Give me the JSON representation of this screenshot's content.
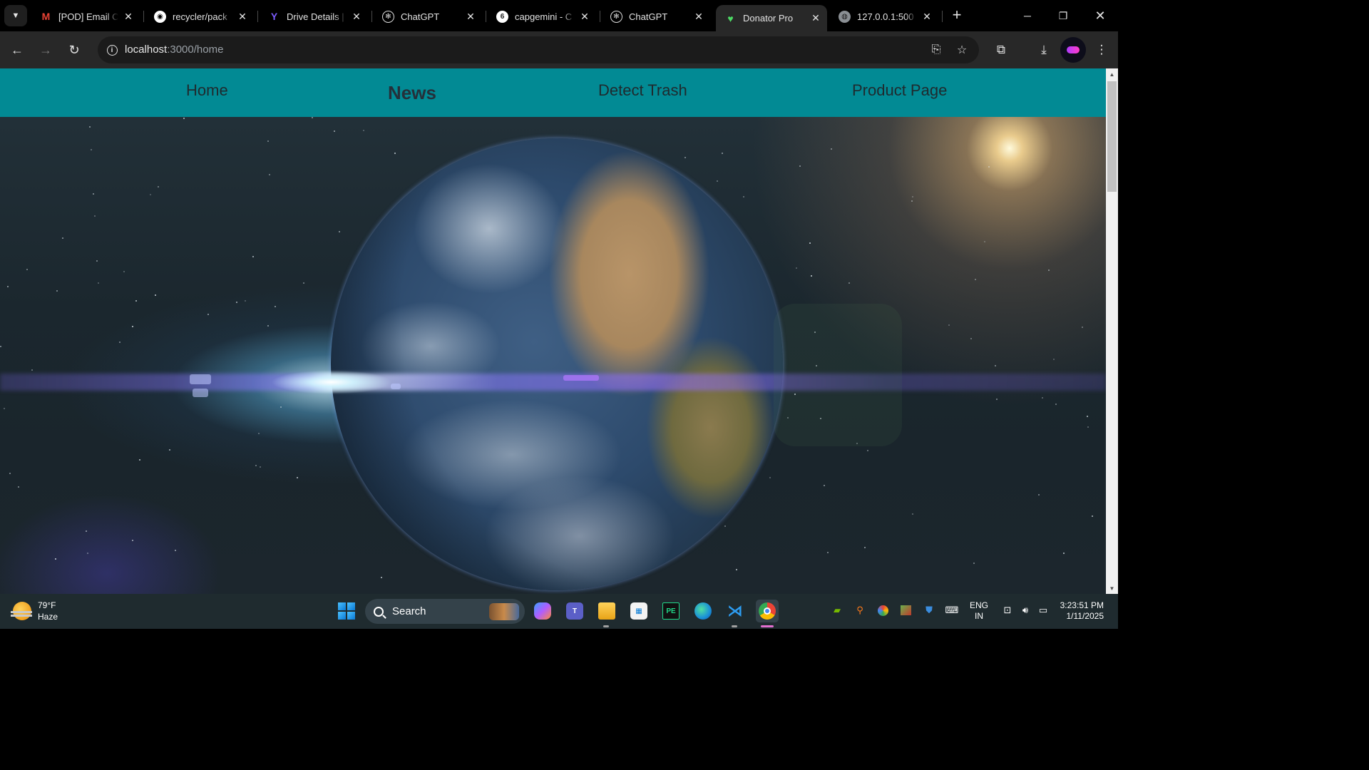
{
  "browser": {
    "tabs": [
      {
        "title": "[POD] Email C",
        "favicon": "gmail-icon",
        "active": false
      },
      {
        "title": "recycler/pack",
        "favicon": "github-icon",
        "active": false
      },
      {
        "title": "Drive Details |",
        "favicon": "drive-details-icon",
        "active": false
      },
      {
        "title": "ChatGPT",
        "favicon": "chatgpt-icon",
        "active": false
      },
      {
        "title": "capgemini - C",
        "favicon": "capgemini-icon",
        "active": false
      },
      {
        "title": "ChatGPT",
        "favicon": "chatgpt-icon",
        "active": false
      },
      {
        "title": "Donator Pro",
        "favicon": "leaf-icon",
        "active": true
      },
      {
        "title": "127.0.0.1:500",
        "favicon": "globe-icon",
        "active": false
      }
    ],
    "close_glyph": "✕",
    "new_tab_glyph": "+",
    "url_host": "localhost",
    "url_path": ":3000/home"
  },
  "site": {
    "nav": [
      {
        "label": "Home",
        "active": false
      },
      {
        "label": "News",
        "active": true
      },
      {
        "label": "Detect Trash",
        "active": false
      },
      {
        "label": "Product Page",
        "active": false
      }
    ],
    "colors": {
      "nav_bg": "#028a94",
      "nav_text": "#1f2a2e"
    }
  },
  "taskbar": {
    "weather_temp": "79°F",
    "weather_desc": "Haze",
    "search_label": "Search",
    "lang_line1": "ENG",
    "lang_line2": "IN",
    "time": "3:23:51 PM",
    "date": "1/11/2025",
    "pinned_apps": [
      "copilot-icon",
      "teams-icon",
      "file-explorer-icon",
      "microsoft-store-icon",
      "pycharm-icon",
      "edge-icon",
      "vscode-icon",
      "chrome-icon"
    ]
  }
}
